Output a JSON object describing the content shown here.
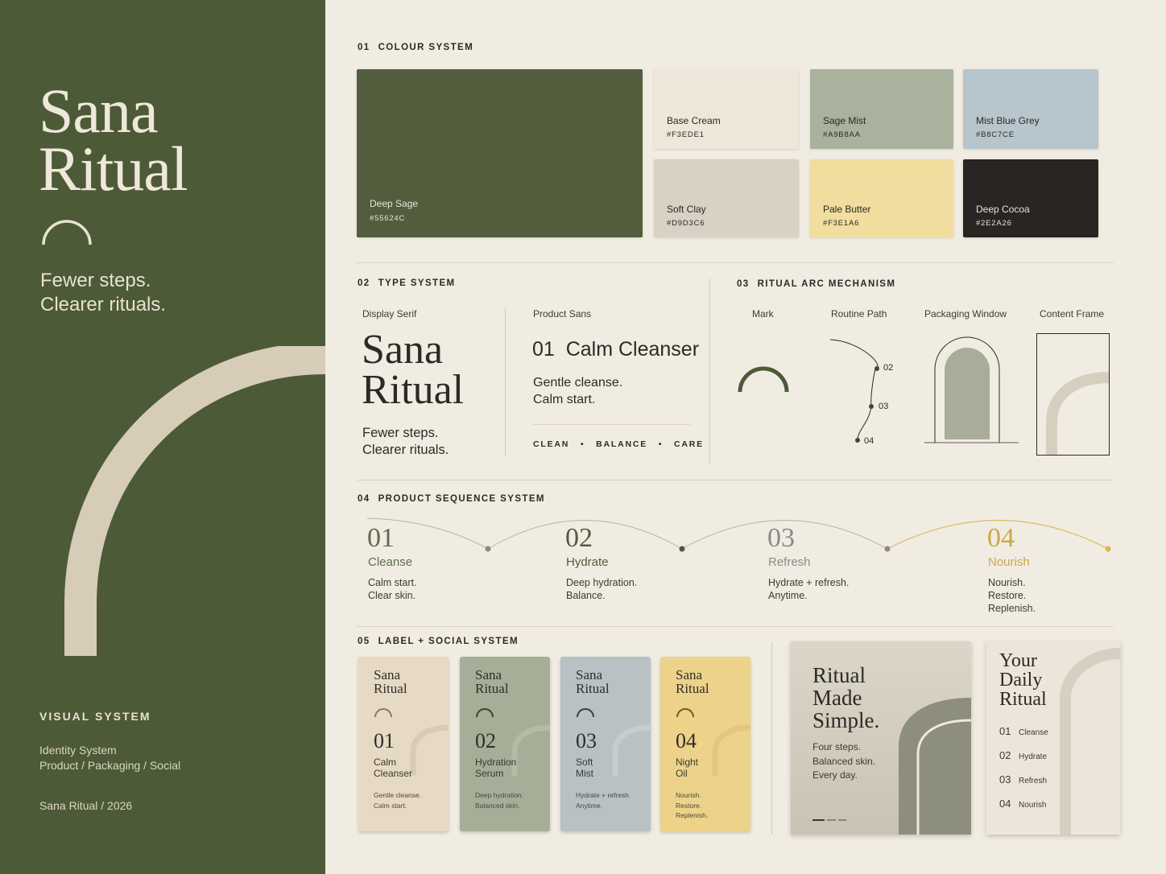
{
  "brand": {
    "name_line1": "Sana",
    "name_line2": "Ritual",
    "tagline_line1": "Fewer steps.",
    "tagline_line2": "Clearer rituals.",
    "visual_system": "VISUAL SYSTEM",
    "identity_line1": "Identity System",
    "identity_line2": "Product / Packaging / Social",
    "year": "Sana Ritual / 2026"
  },
  "colour": {
    "num": "01",
    "title": "COLOUR SYSTEM",
    "swatches": [
      {
        "name": "Deep Sage",
        "hex": "#55624C"
      },
      {
        "name": "Base Cream",
        "hex": "#F3EDE1"
      },
      {
        "name": "Sage Mist",
        "hex": "#A9B8AA"
      },
      {
        "name": "Mist Blue Grey",
        "hex": "#B8C7CE"
      },
      {
        "name": "Soft Clay",
        "hex": "#D9D3C6"
      },
      {
        "name": "Pale Butter",
        "hex": "#F3E1A6"
      },
      {
        "name": "Deep Cocoa",
        "hex": "#2E2A26"
      }
    ]
  },
  "type": {
    "num": "02",
    "title": "TYPE SYSTEM",
    "serif_label": "Display Serif",
    "serif_line1": "Sana",
    "serif_line2": "Ritual",
    "serif_tag1": "Fewer steps.",
    "serif_tag2": "Clearer rituals.",
    "sans_label": "Product Sans",
    "sans_product": "01  Calm Cleanser",
    "sans_line1": "Gentle cleanse.",
    "sans_line2": "Calm start.",
    "kw1": "CLEAN",
    "kw2": "BALANCE",
    "kw3": "CARE",
    "sep": "•"
  },
  "arc": {
    "num": "03",
    "title": "RITUAL ARC MECHANISM",
    "labels": [
      "Mark",
      "Routine Path",
      "Packaging Window",
      "Content Frame"
    ],
    "path_points": [
      "02",
      "03",
      "04"
    ]
  },
  "sequence": {
    "num": "04",
    "title": "PRODUCT SEQUENCE SYSTEM",
    "steps": [
      {
        "num": "01",
        "name": "Cleanse",
        "l1": "Calm start.",
        "l2": "Clear skin.",
        "l3": ""
      },
      {
        "num": "02",
        "name": "Hydrate",
        "l1": "Deep hydration.",
        "l2": "Balance.",
        "l3": ""
      },
      {
        "num": "03",
        "name": "Refresh",
        "l1": "Hydrate + refresh.",
        "l2": "Anytime.",
        "l3": ""
      },
      {
        "num": "04",
        "name": "Nourish",
        "l1": "Nourish.",
        "l2": "Restore.",
        "l3": "Replenish."
      }
    ],
    "accent": "#C9A84A"
  },
  "labels": {
    "num": "05",
    "title": "LABEL + SOCIAL SYSTEM",
    "cards": [
      {
        "b1": "Sana",
        "b2": "Ritual",
        "num": "01",
        "n1": "Calm",
        "n2": "Cleanser",
        "d1": "Gentle cleanse.",
        "d2": "Calm start.",
        "d3": "",
        "bg": "#E6DAC4"
      },
      {
        "b1": "Sana",
        "b2": "Ritual",
        "num": "02",
        "n1": "Hydration",
        "n2": "Serum",
        "d1": "Deep hydration.",
        "d2": "Balanced skin.",
        "d3": "",
        "bg": "#A6AE98"
      },
      {
        "b1": "Sana",
        "b2": "Ritual",
        "num": "03",
        "n1": "Soft",
        "n2": "Mist",
        "d1": "Hydrate + refresh.",
        "d2": "Anytime.",
        "d3": "",
        "bg": "#B8C1C4"
      },
      {
        "b1": "Sana",
        "b2": "Ritual",
        "num": "04",
        "n1": "Night",
        "n2": "Oil",
        "d1": "Nourish.",
        "d2": "Restore.",
        "d3": "Replenish.",
        "bg": "#EDD38A"
      }
    ],
    "post1": {
      "h1": "Ritual",
      "h2": "Made",
      "h3": "Simple.",
      "b1": "Four steps.",
      "b2": "Balanced skin.",
      "b3": "Every day."
    },
    "post2": {
      "h1": "Your",
      "h2": "Daily",
      "h3": "Ritual",
      "items": [
        {
          "num": "01",
          "name": "Cleanse"
        },
        {
          "num": "02",
          "name": "Hydrate"
        },
        {
          "num": "03",
          "name": "Refresh"
        },
        {
          "num": "04",
          "name": "Nourish"
        }
      ]
    }
  }
}
